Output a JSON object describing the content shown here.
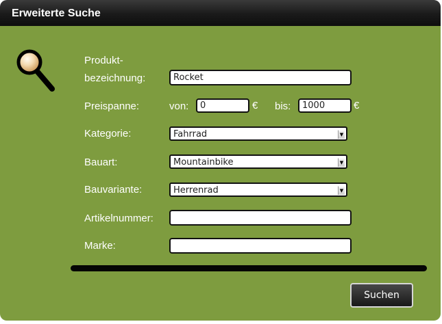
{
  "header": {
    "title": "Erweiterte Suche"
  },
  "form": {
    "product_label_line1": "Produkt-",
    "product_label_line2": "bezeichnung:",
    "product_value": "Rocket",
    "price_label": "Preispanne:",
    "from_label": "von:",
    "from_value": "0",
    "from_currency": "€",
    "to_label": "bis:",
    "to_value": "1000",
    "to_currency": "€",
    "category_label": "Kategorie:",
    "category_value": "Fahrrad",
    "type_label": "Bauart:",
    "type_value": "Mountainbike",
    "variant_label": "Bauvariante:",
    "variant_value": "Herrenrad",
    "article_label": "Artikelnummer:",
    "article_value": "",
    "brand_label": "Marke:",
    "brand_value": ""
  },
  "actions": {
    "search_label": "Suchen"
  },
  "icons": {
    "search": "magnifier-icon"
  },
  "colors": {
    "panel_green": "#7e9c3f",
    "header_dark": "#1a1a1a",
    "divider": "#050505"
  }
}
